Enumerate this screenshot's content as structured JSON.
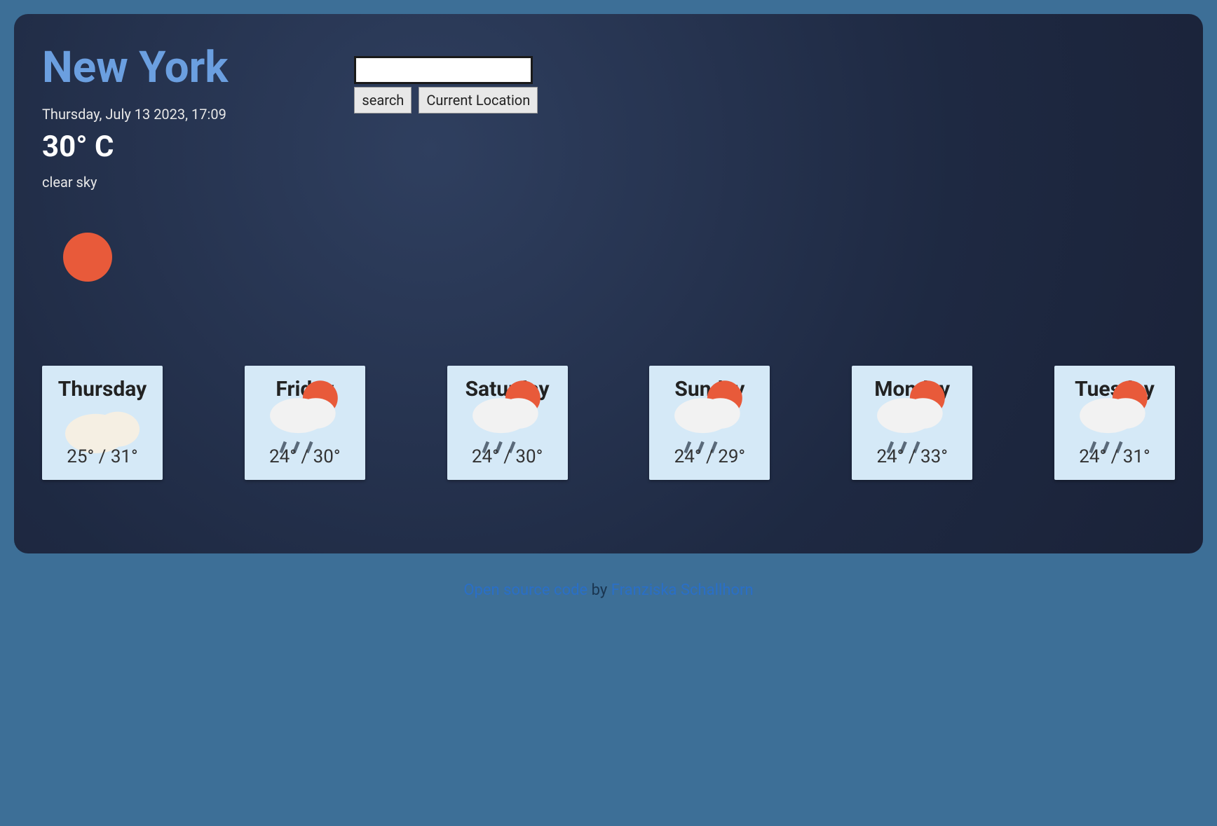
{
  "current": {
    "city": "New York",
    "datetime": "Thursday, July 13 2023, 17:09",
    "temp": "30° C",
    "description": "clear sky",
    "icon": "clear"
  },
  "search": {
    "placeholder": "",
    "value": "",
    "search_label": "search",
    "location_label": "Current Location"
  },
  "forecast": [
    {
      "day": "Thursday",
      "min": "25°",
      "max": "31°",
      "icon": "cloudy"
    },
    {
      "day": "Friday",
      "min": "24°",
      "max": "30°",
      "icon": "rain"
    },
    {
      "day": "Saturday",
      "min": "24°",
      "max": "30°",
      "icon": "rain"
    },
    {
      "day": "Sunday",
      "min": "24°",
      "max": "29°",
      "icon": "rain"
    },
    {
      "day": "Monday",
      "min": "24°",
      "max": "33°",
      "icon": "rain"
    },
    {
      "day": "Tuesday",
      "min": "24°",
      "max": "31°",
      "icon": "rain"
    }
  ],
  "footer": {
    "link1_text": "Open source code",
    "by": " by ",
    "link2_text": "Franziska Schallhorn"
  }
}
